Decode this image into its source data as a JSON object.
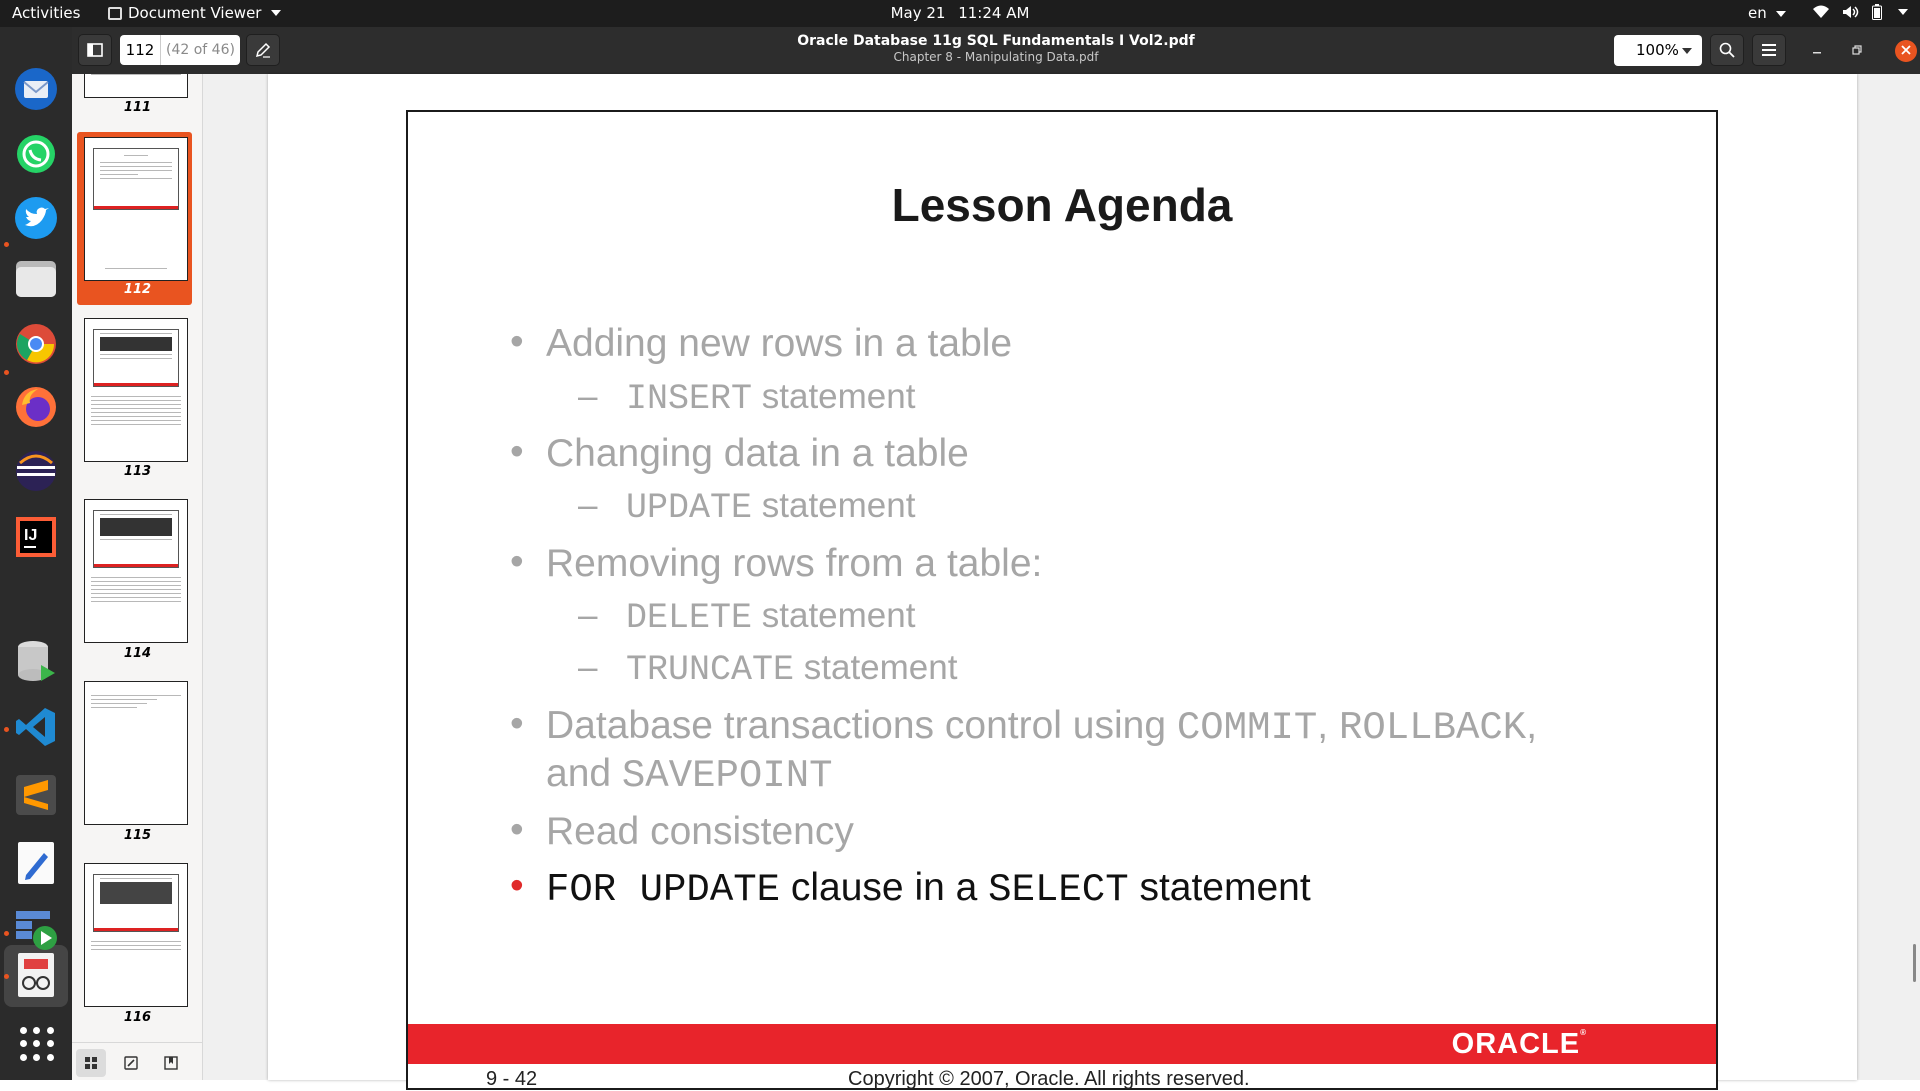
{
  "topbar": {
    "activities": "Activities",
    "app_name": "Document Viewer",
    "date": "May 21",
    "time": "11:24 AM",
    "language": "en",
    "tray_icons": [
      "wifi-icon",
      "volume-icon",
      "battery-icon",
      "power-menu-icon"
    ]
  },
  "dock": {
    "apps": [
      "thunderbird",
      "whatsapp",
      "twitter",
      "files",
      "chrome",
      "firefox",
      "eclipse",
      "intellij-idea",
      "database-tool",
      "vscode",
      "sublime-text",
      "text-editor",
      "remote-desktop",
      "document-viewer"
    ],
    "show_apps_label": "Show Applications"
  },
  "header": {
    "current_page": "112",
    "page_count": "(42 of 46)",
    "title": "Oracle Database 11g SQL Fundamentals I  Vol2.pdf",
    "subtitle": "Chapter 8 - Manipulating Data.pdf",
    "zoom": "100%"
  },
  "sidebar": {
    "thumbnails": [
      {
        "label": "111",
        "selected": false
      },
      {
        "label": "112",
        "selected": true
      },
      {
        "label": "113",
        "selected": false
      },
      {
        "label": "114",
        "selected": false
      },
      {
        "label": "115",
        "selected": false
      },
      {
        "label": "116",
        "selected": false
      }
    ],
    "selected_color": "#e95420"
  },
  "slide": {
    "title": "Lesson Agenda",
    "b1": "Adding new rows in a table",
    "b1_sub_code": "INSERT",
    "b1_sub_text": " statement",
    "b2": "Changing data in a table",
    "b2_sub_code": "UPDATE",
    "b2_sub_text": " statement",
    "b3": "Removing rows from a table:",
    "b3_sub1_code": "DELETE",
    "b3_sub1_text": " statement",
    "b3_sub2_code": "TRUNCATE",
    "b3_sub2_text": " statement",
    "b4_text1": "Database transactions control using ",
    "b4_code1": "COMMIT",
    "b4_sep1": ", ",
    "b4_code2": "ROLLBACK",
    "b4_sep2": ",",
    "b4_line2_text": "and ",
    "b4_code3": "SAVEPOINT",
    "b5": "Read consistency",
    "b6_code1": "FOR UPDATE",
    "b6_text1": " clause in a ",
    "b6_code2": "SELECT",
    "b6_text2": " statement",
    "bullet": "•",
    "dash": "–",
    "logo": "ORACLE",
    "logo_mark": "®",
    "footer_page": "9 - 42",
    "footer_copyright": "Copyright © 2007, Oracle. All rights reserved.",
    "accent_color": "#e8242b"
  }
}
